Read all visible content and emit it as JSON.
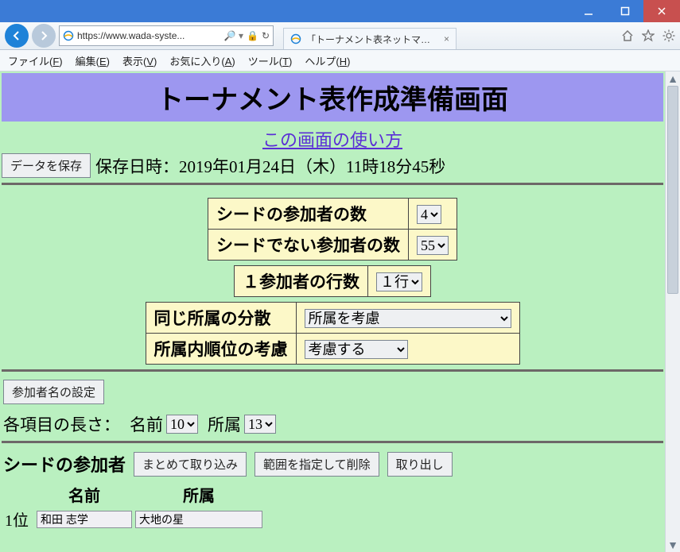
{
  "window": {
    "url_display": "https://www.wada-syste...",
    "search_hint": "",
    "tab_title": "「トーナメント表ネットマネージャ...",
    "menus": {
      "file": "ファイル(F)",
      "edit": "編集(E)",
      "view": "表示(V)",
      "fav": "お気に入り(A)",
      "tools": "ツール(T)",
      "help": "ヘルプ(H)"
    }
  },
  "page": {
    "banner_title": "トーナメント表作成準備画面",
    "usage_link": "この画面の使い方",
    "save_button": "データを保存",
    "save_timestamp": "保存日時：2019年01月24日（木）11時18分45秒",
    "cfg": {
      "seed_count_label": "シードの参加者の数",
      "seed_count_value": "4",
      "nonseed_count_label": "シードでない参加者の数",
      "nonseed_count_value": "55",
      "lines_label": "１参加者の行数",
      "lines_value": "１行",
      "spread_label": "同じ所属の分散",
      "spread_value": "所属を考慮",
      "rank_label": "所属内順位の考慮",
      "rank_value": "考慮する"
    },
    "participant": {
      "settings_button": "参加者名の設定",
      "length_header": "各項目の長さ：",
      "name_label": "名前",
      "name_len": "10",
      "aff_label": "所属",
      "aff_len": "13"
    },
    "seed": {
      "title": "シードの参加者",
      "btn_import": "まとめて取り込み",
      "btn_delete": "範囲を指定して削除",
      "btn_export": "取り出し",
      "col_name": "名前",
      "col_aff": "所属",
      "rows": [
        {
          "rank": "1位",
          "name": "和田 志学",
          "aff": "大地の星"
        }
      ]
    }
  }
}
